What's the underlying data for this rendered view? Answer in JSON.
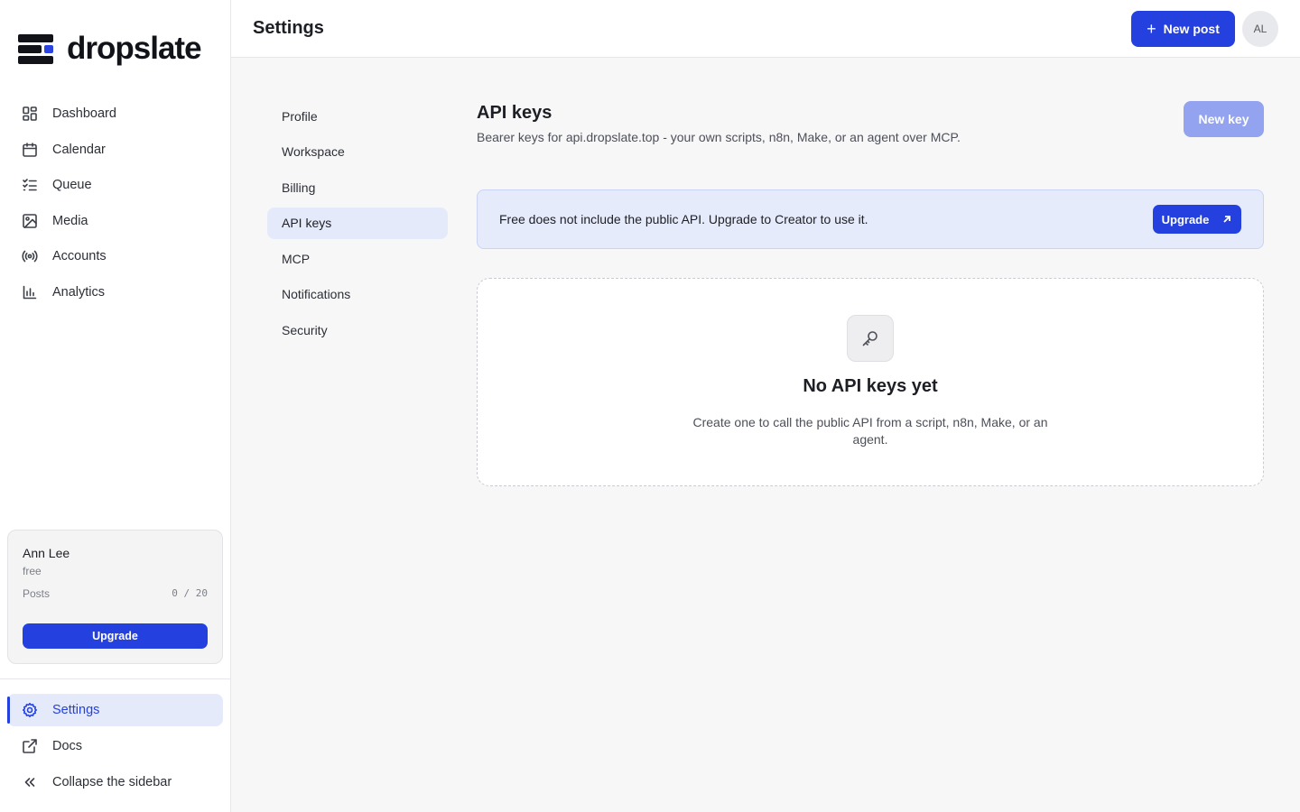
{
  "brand": {
    "name": "dropslate",
    "accent": "#2441e0"
  },
  "sidebar": {
    "items": [
      {
        "label": "Dashboard",
        "icon": "dashboard-icon"
      },
      {
        "label": "Calendar",
        "icon": "calendar-icon"
      },
      {
        "label": "Queue",
        "icon": "queue-icon"
      },
      {
        "label": "Media",
        "icon": "image-icon"
      },
      {
        "label": "Accounts",
        "icon": "broadcast-icon"
      },
      {
        "label": "Analytics",
        "icon": "bar-chart-icon"
      }
    ],
    "plan_card": {
      "user_name": "Ann Lee",
      "tier": "free",
      "usage_label": "Posts",
      "usage_value": "0 / 20",
      "upgrade_label": "Upgrade"
    },
    "bottom_items": [
      {
        "label": "Settings",
        "icon": "gear-icon",
        "active": true
      },
      {
        "label": "Docs",
        "icon": "external-link-icon"
      },
      {
        "label": "Collapse the sidebar",
        "icon": "chevrons-left-icon"
      }
    ]
  },
  "header": {
    "title": "Settings",
    "new_post_label": "New post",
    "avatar_initials": "AL"
  },
  "settings_nav": {
    "items": [
      "Profile",
      "Workspace",
      "Billing",
      "API keys",
      "MCP",
      "Notifications",
      "Security"
    ],
    "active": "API keys"
  },
  "api_keys": {
    "title": "API keys",
    "subtitle": "Bearer keys for api.dropslate.top - your own scripts, n8n, Make, or an agent over MCP.",
    "new_key_label": "New key",
    "banner_text": "Free does not include the public API. Upgrade to Creator to use it.",
    "banner_button": "Upgrade",
    "empty_title": "No API keys yet",
    "empty_desc": "Create one to call the public API from a script, n8n, Make, or an agent."
  }
}
